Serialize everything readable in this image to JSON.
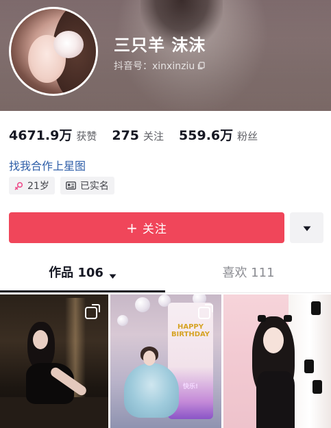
{
  "profile": {
    "nickname": "三只羊 沫沫",
    "douyin_id": "抖音号：xinxinziu",
    "copy_icon": "copy-icon"
  },
  "stats": [
    {
      "value": "4671.9万",
      "label": "获赞"
    },
    {
      "value": "275",
      "label": "关注"
    },
    {
      "value": "559.6万",
      "label": "粉丝"
    }
  ],
  "cooperate_link": "找我合作上星图",
  "tags": [
    {
      "icon": "female-icon",
      "label": "21岁"
    },
    {
      "icon": "id-card-icon",
      "label": "已实名"
    }
  ],
  "actions": {
    "follow_label": "关注",
    "follow_plus": "+",
    "more_icon": "caret-down-icon"
  },
  "tabs": [
    {
      "label": "作品 106",
      "active": true
    },
    {
      "label": "喜欢 111",
      "active": false
    }
  ],
  "thumbnails": [
    {
      "overlay_text": "",
      "sub_text": ""
    },
    {
      "overlay_text": "HAPPY BIRTHDAY",
      "sub_text": "快乐!"
    },
    {
      "overlay_text": "",
      "sub_text": ""
    }
  ],
  "colors": {
    "follow_button": "#f0465a",
    "link": "#2e5ea8",
    "tag_bg": "#f2f2f4",
    "female_icon": "#ee4f8c"
  }
}
